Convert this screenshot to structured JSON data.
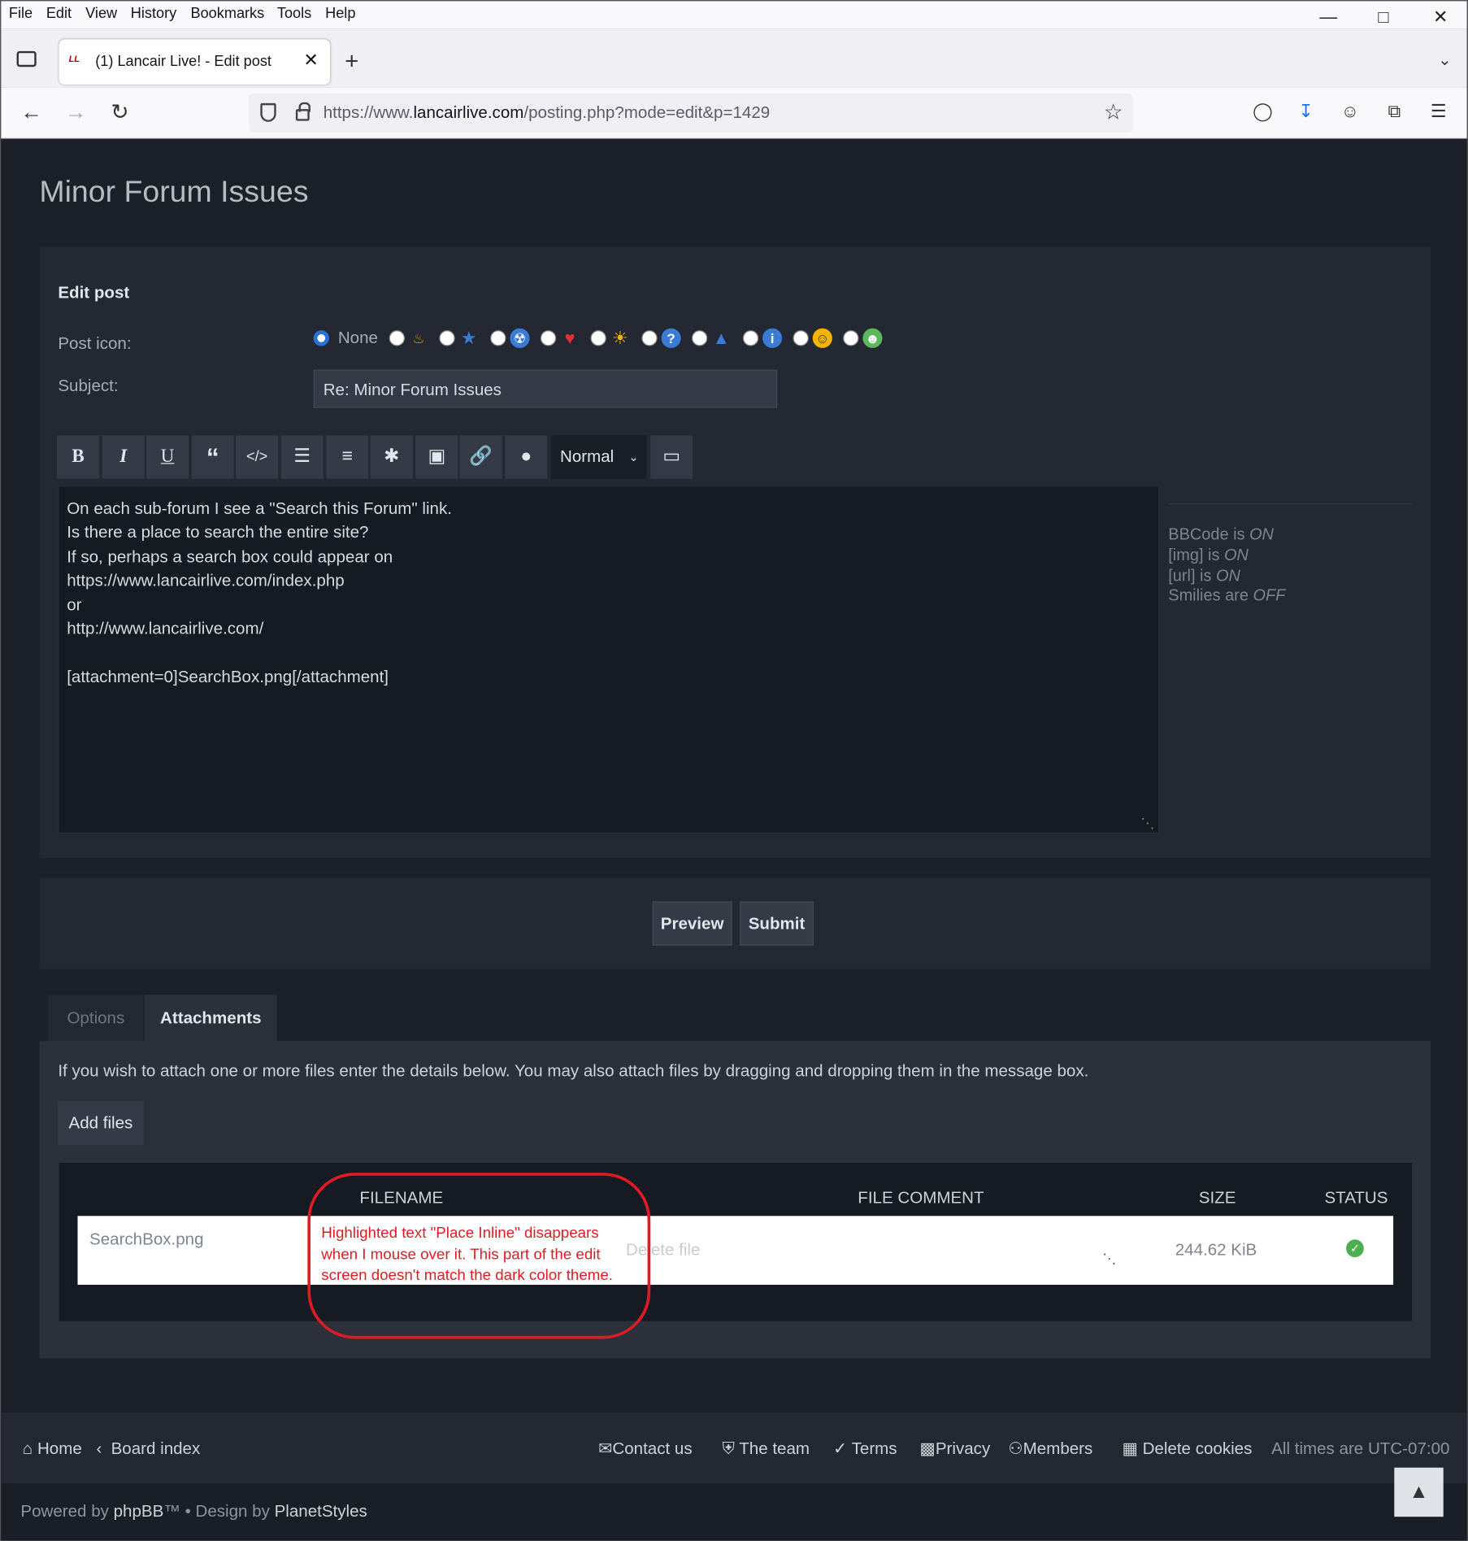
{
  "menu": [
    "File",
    "Edit",
    "View",
    "History",
    "Bookmarks",
    "Tools",
    "Help"
  ],
  "browser": {
    "tab_title": "(1) Lancair Live! - Edit post",
    "url_prefix": "https://www.",
    "url_domain": "lancairlive.com",
    "url_path": "/posting.php?mode=edit&p=1429"
  },
  "page": {
    "title": "Minor Forum Issues",
    "edit_post_label": "Edit post",
    "post_icon_label": "Post icon:",
    "post_icon_none": "None",
    "subject_label": "Subject:",
    "subject_value": "Re: Minor Forum Issues"
  },
  "toolbar": {
    "font_size": "Normal",
    "buttons": [
      "B",
      "I",
      "U",
      "quote",
      "code",
      "list",
      "list-numbered",
      "list-item",
      "image",
      "link",
      "color"
    ]
  },
  "message_lines": [
    "On each sub-forum I see a \"Search this Forum\" link.",
    "Is there a place to search the entire site?",
    "If so, perhaps a search box could appear on",
    "https://www.lancairlive.com/index.php",
    "or",
    "http://www.lancairlive.com/",
    "",
    "[attachment=0]SearchBox.png[/attachment]"
  ],
  "bbcode_status": {
    "bbcode_label": "BBCode is ",
    "bbcode_value": "ON",
    "img_label": "[img] is ",
    "img_value": "ON",
    "url_label": "[url] is ",
    "url_value": "ON",
    "smilies_label": "Smilies are ",
    "smilies_value": "OFF"
  },
  "actions": {
    "preview": "Preview",
    "submit": "Submit"
  },
  "tabs": {
    "options": "Options",
    "attachments": "Attachments"
  },
  "attachments": {
    "info": "If you wish to attach one or more files enter the details below. You may also attach files by dragging and dropping them in the message box.",
    "add_files": "Add files",
    "col_filename": "FILENAME",
    "col_comment": "FILE COMMENT",
    "col_size": "SIZE",
    "col_status": "STATUS",
    "file_name": "SearchBox.png",
    "delete_file": "Delete file",
    "file_size": "244.62 KiB"
  },
  "annotation": [
    "Highlighted text \"Place Inline\" disappears",
    "when I mouse over it. This part of the edit",
    "screen doesn't match the dark color theme."
  ],
  "footer": {
    "home": "Home",
    "board_index": "Board index",
    "contact": "Contact us",
    "team": "The team",
    "terms": "Terms",
    "privacy": "Privacy",
    "members": "Members",
    "delete_cookies": "Delete cookies",
    "timezone": "All times are UTC-07:00",
    "powered_by": "Powered by ",
    "phpbb": "phpBB",
    "tm": "™ • Design by ",
    "designer": "PlanetStyles"
  },
  "colors": {
    "accent": "#2b6fdb",
    "annotation": "#e01b24",
    "status_ok": "#4caf50"
  }
}
